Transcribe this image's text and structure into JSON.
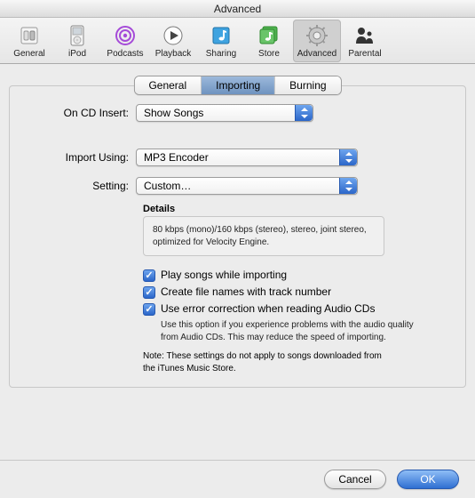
{
  "window": {
    "title": "Advanced"
  },
  "toolbar": {
    "items": [
      {
        "id": "general",
        "label": "General"
      },
      {
        "id": "ipod",
        "label": "iPod"
      },
      {
        "id": "podcasts",
        "label": "Podcasts"
      },
      {
        "id": "playback",
        "label": "Playback"
      },
      {
        "id": "sharing",
        "label": "Sharing"
      },
      {
        "id": "store",
        "label": "Store"
      },
      {
        "id": "advanced",
        "label": "Advanced"
      },
      {
        "id": "parental",
        "label": "Parental"
      }
    ],
    "selected": "advanced"
  },
  "tabs": {
    "items": [
      "General",
      "Importing",
      "Burning"
    ],
    "selected": "Importing"
  },
  "labels": {
    "on_cd_insert": "On CD Insert:",
    "import_using": "Import Using:",
    "setting": "Setting:",
    "details_title": "Details"
  },
  "selects": {
    "on_cd_insert": "Show Songs",
    "import_using": "MP3 Encoder",
    "setting": "Custom…"
  },
  "details_text": "80 kbps (mono)/160 kbps (stereo), stereo, joint stereo, optimized for Velocity Engine.",
  "checks": {
    "play_while_importing": {
      "checked": true,
      "label": "Play songs while importing"
    },
    "filenames_with_track": {
      "checked": true,
      "label": "Create file names with track number"
    },
    "error_correction": {
      "checked": true,
      "label": "Use error correction when reading Audio CDs",
      "help": "Use this option if you experience problems with the audio quality from Audio CDs. This may reduce the speed of importing."
    }
  },
  "note": "Note: These settings do not apply to songs downloaded from the iTunes Music Store.",
  "buttons": {
    "cancel": "Cancel",
    "ok": "OK"
  }
}
